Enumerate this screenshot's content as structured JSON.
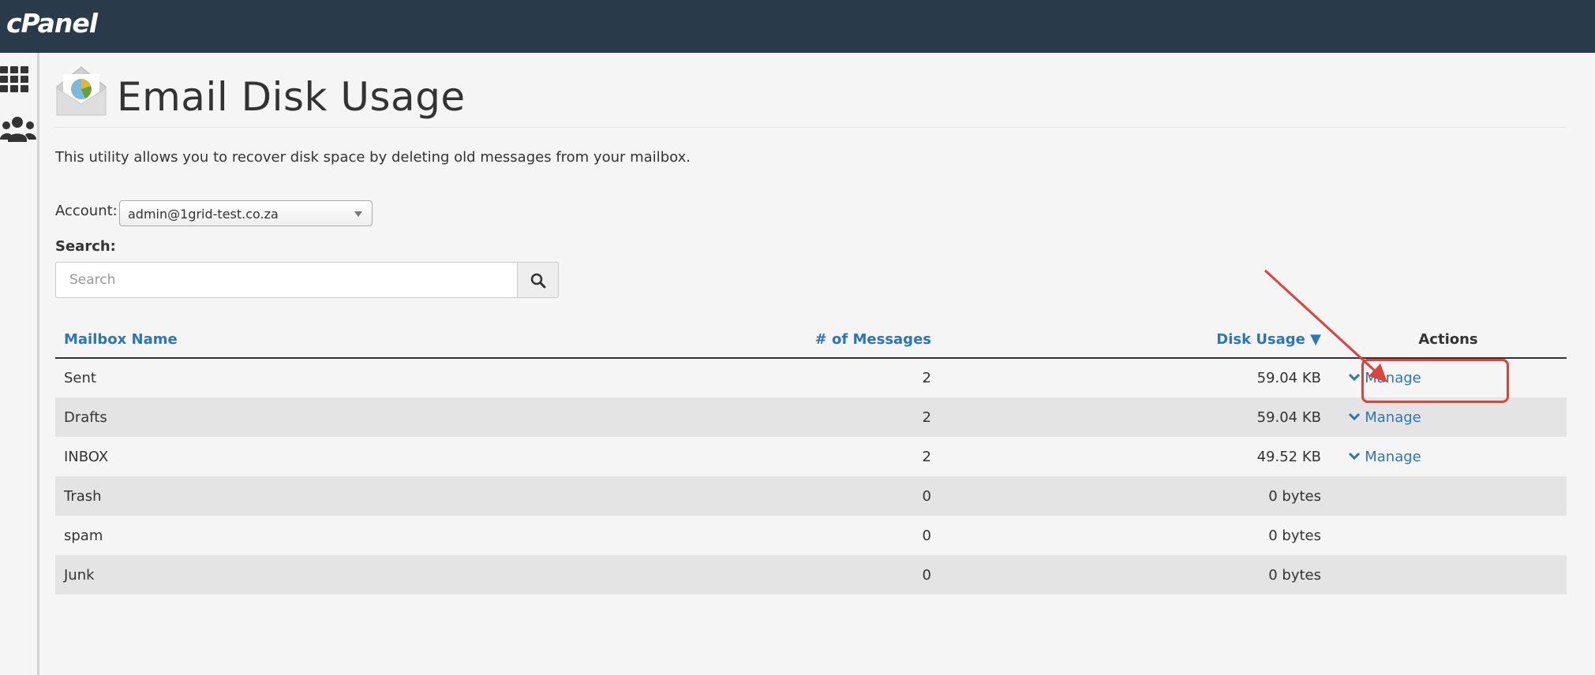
{
  "header": {
    "logo_text": "cPanel",
    "bg_color": "#293a4a"
  },
  "sidebar": {
    "items": [
      {
        "icon": "grid-icon"
      },
      {
        "icon": "users-icon"
      }
    ]
  },
  "page": {
    "title": "Email Disk Usage",
    "description": "This utility allows you to recover disk space by deleting old messages from your mailbox."
  },
  "account": {
    "label": "Account:",
    "selected": "admin@1grid-test.co.za"
  },
  "search": {
    "label": "Search:",
    "placeholder": "Search"
  },
  "table": {
    "headers": {
      "name": "Mailbox Name",
      "messages": "# of Messages",
      "usage": "Disk Usage ▼",
      "actions": "Actions"
    },
    "rows": [
      {
        "name": "Sent",
        "messages": "2",
        "usage": "59.04 KB",
        "action": "Manage"
      },
      {
        "name": "Drafts",
        "messages": "2",
        "usage": "59.04 KB",
        "action": "Manage"
      },
      {
        "name": "INBOX",
        "messages": "2",
        "usage": "49.52 KB",
        "action": "Manage"
      },
      {
        "name": "Trash",
        "messages": "0",
        "usage": "0 bytes",
        "action": ""
      },
      {
        "name": "spam",
        "messages": "0",
        "usage": "0 bytes",
        "action": ""
      },
      {
        "name": "Junk",
        "messages": "0",
        "usage": "0 bytes",
        "action": ""
      }
    ]
  },
  "colors": {
    "link": "#2e75b6",
    "annotation": "#d9453a"
  }
}
